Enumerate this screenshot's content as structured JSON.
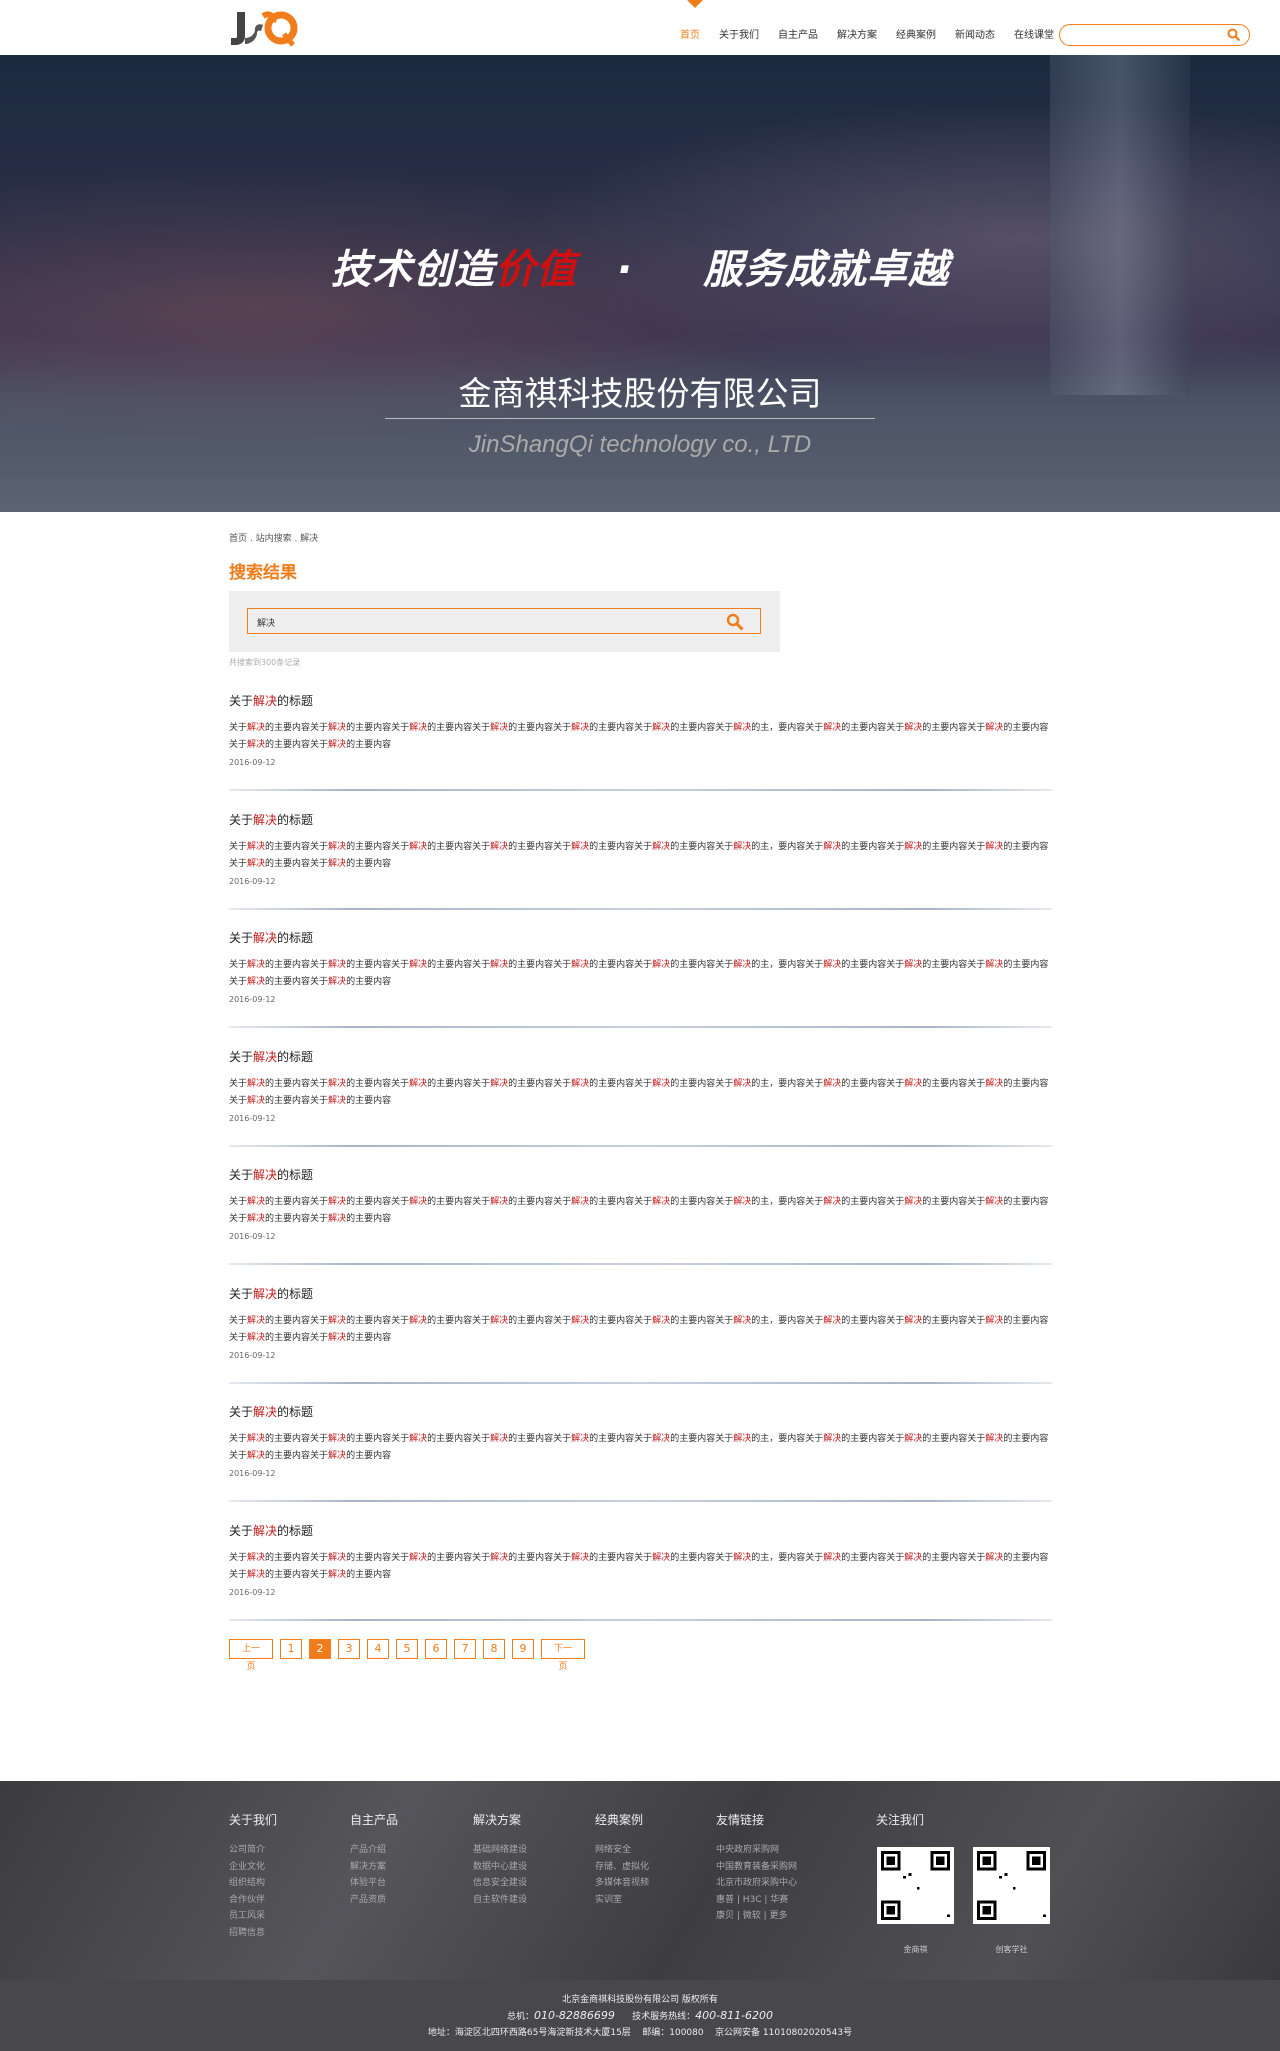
{
  "header": {
    "logo_text": "JSQ",
    "nav": [
      "首页",
      "关于我们",
      "自主产品",
      "解决方案",
      "经典案例",
      "新闻动态",
      "在线课堂"
    ],
    "active_nav": 0,
    "search_placeholder": ""
  },
  "hero": {
    "slogan_a": "技术创造",
    "slogan_a_red": "价值",
    "slogan_dot": "·",
    "slogan_b": "服务成就卓越",
    "company_cn": "金商祺科技股份有限公司",
    "company_en": "JinShangQi technology co., LTD"
  },
  "breadcrumb": "首页 . 站内搜索 . 解决",
  "page_title": "搜索结果",
  "search": {
    "value": "解决",
    "count_text": "共搜索到300条记录"
  },
  "results": [
    {
      "title": [
        [
          "关于",
          0
        ],
        [
          "解决",
          1
        ],
        [
          "的标题",
          0
        ]
      ],
      "date": "2016-09-12"
    },
    {
      "title": [
        [
          "关于",
          0
        ],
        [
          "解决",
          1
        ],
        [
          "的标题",
          0
        ]
      ],
      "date": "2016-09-12"
    },
    {
      "title": [
        [
          "关于",
          0
        ],
        [
          "解决",
          1
        ],
        [
          "的标题",
          0
        ]
      ],
      "date": "2016-09-12"
    },
    {
      "title": [
        [
          "关于",
          0
        ],
        [
          "解决",
          1
        ],
        [
          "的标题",
          0
        ]
      ],
      "date": "2016-09-12"
    },
    {
      "title": [
        [
          "关于",
          0
        ],
        [
          "解决",
          1
        ],
        [
          "的标题",
          0
        ]
      ],
      "date": "2016-09-12"
    },
    {
      "title": [
        [
          "关于",
          0
        ],
        [
          "解决",
          1
        ],
        [
          "的标题",
          0
        ]
      ],
      "date": "2016-09-12"
    },
    {
      "title": [
        [
          "关于",
          0
        ],
        [
          "解决",
          1
        ],
        [
          "的标题",
          0
        ]
      ],
      "date": "2016-09-12"
    },
    {
      "title": [
        [
          "关于",
          0
        ],
        [
          "解决",
          1
        ],
        [
          "的标题",
          0
        ]
      ],
      "date": "2016-09-12"
    }
  ],
  "result_description": [
    [
      "关于",
      0
    ],
    [
      "解决",
      1
    ],
    [
      "的主要内容关于",
      0
    ],
    [
      "解决",
      1
    ],
    [
      "的主要内容关于",
      0
    ],
    [
      "解决",
      1
    ],
    [
      "的主要内容关于",
      0
    ],
    [
      "解决",
      1
    ],
    [
      "的主要内容关于",
      0
    ],
    [
      "解决",
      1
    ],
    [
      "的主要内容关于",
      0
    ],
    [
      "解决",
      1
    ],
    [
      "的主要内容关于",
      0
    ],
    [
      "解决",
      1
    ],
    [
      "的主，要内容关于",
      0
    ],
    [
      "解决",
      1
    ],
    [
      "的主要内容关于",
      0
    ],
    [
      "解决",
      1
    ],
    [
      "的主要内容关于",
      0
    ],
    [
      "解决",
      1
    ],
    [
      "的主要内容关于",
      0
    ],
    [
      "解决",
      1
    ],
    [
      "的主要内容关于",
      0
    ],
    [
      "解决",
      1
    ],
    [
      "的主要内容",
      0
    ]
  ],
  "pagination": {
    "prev": "上一页",
    "pages": [
      "1",
      "2",
      "3",
      "4",
      "5",
      "6",
      "7",
      "8",
      "9"
    ],
    "current": "2",
    "next": "下一页"
  },
  "footer": {
    "columns": [
      {
        "title": "关于我们",
        "links": [
          "公司简介",
          "企业文化",
          "组织结构",
          "合作伙伴",
          "员工风采",
          "招聘信息"
        ]
      },
      {
        "title": "自主产品",
        "links": [
          "产品介绍",
          "解决方案",
          "体验平台",
          "产品资质"
        ]
      },
      {
        "title": "解决方案",
        "links": [
          "基础网络建设",
          "数据中心建设",
          "信息安全建设",
          "自主软件建设"
        ]
      },
      {
        "title": "经典案例",
        "links": [
          "网络安全",
          "存储、虚拟化",
          "多媒体音视频",
          "实训室"
        ]
      },
      {
        "title": "友情链接",
        "links": [
          "中央政府采购网",
          "中国教育装备采购网",
          "北京市政府采购中心",
          "惠普 | H3C | 华赛",
          "康贝 | 微软 | 更多"
        ]
      }
    ],
    "follow_title": "关注我们",
    "qr_labels": [
      "金商祺",
      "创客学社"
    ],
    "copyright": "北京金商祺科技股份有限公司  版权所有",
    "phone_label": "总机：",
    "phone": "010-82886699",
    "hotline_label": "技术服务热线：",
    "hotline": "400-811-6200",
    "address": "地址：海淀区北四环西路65号海淀新技术大厦15层    邮编：100080    京公网安备 11010802020543号"
  },
  "colors": {
    "accent": "#f07c1c",
    "highlight": "#c01818"
  }
}
